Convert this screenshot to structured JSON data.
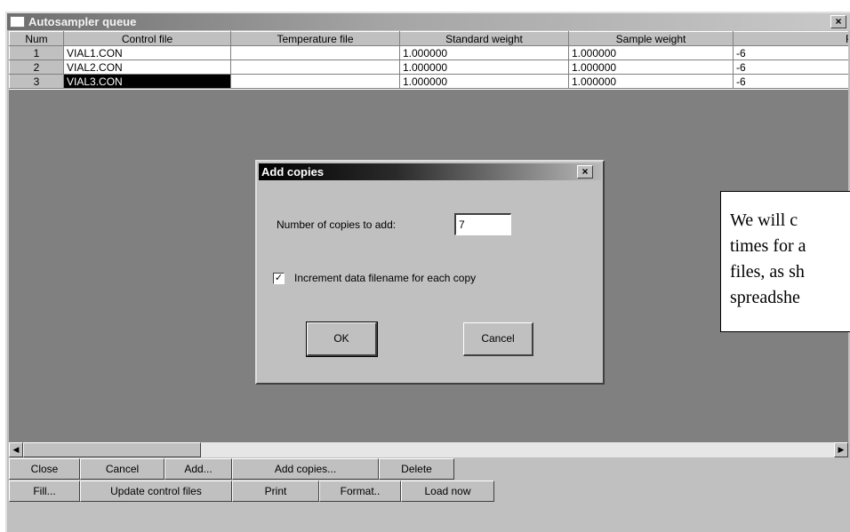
{
  "window": {
    "title": "Autosampler queue",
    "close_glyph": "×"
  },
  "grid": {
    "columns": [
      "Num",
      "Control file",
      "Temperature file",
      "Standard weight",
      "Sample weight",
      "Recalib. le"
    ],
    "rows": [
      {
        "num": "1",
        "control": "VIAL1.CON",
        "temperature": "",
        "standard": "1.000000",
        "sample": "1.000000",
        "recalib": "-6"
      },
      {
        "num": "2",
        "control": "VIAL2.CON",
        "temperature": "",
        "standard": "1.000000",
        "sample": "1.000000",
        "recalib": "-6"
      },
      {
        "num": "3",
        "control": "VIAL3.CON",
        "temperature": "",
        "standard": "1.000000",
        "sample": "1.000000",
        "recalib": "-6"
      }
    ]
  },
  "scrollbar": {
    "left_glyph": "◀",
    "right_glyph": "▶"
  },
  "toolbar": {
    "row1": [
      "Close",
      "Cancel",
      "Add...",
      "Add copies...",
      "Delete"
    ],
    "row2": [
      "Fill...",
      "Update control files",
      "Print",
      "Format..",
      "Load now"
    ]
  },
  "dialog": {
    "title": "Add copies",
    "close_glyph": "×",
    "copies_label": "Number of copies to add:",
    "copies_value": "7",
    "increment_checked": true,
    "check_glyph": "✓",
    "increment_label": "Increment data filename for each copy",
    "ok_label": "OK",
    "cancel_label": "Cancel"
  },
  "callout": {
    "lines": [
      "We will c",
      "times for a",
      "files, as sh",
      "spreadshe"
    ]
  },
  "icons": {
    "window_icon": "window-icon",
    "close_icon": "close-icon",
    "check_icon": "checkmark-icon",
    "scroll_left": "arrow-left-icon",
    "scroll_right": "arrow-right-icon"
  },
  "colors": {
    "face": "#c0c0c0",
    "workspace": "#808080",
    "selection": "#000000",
    "active_title": "#000000",
    "inactive_title": "#808080"
  }
}
